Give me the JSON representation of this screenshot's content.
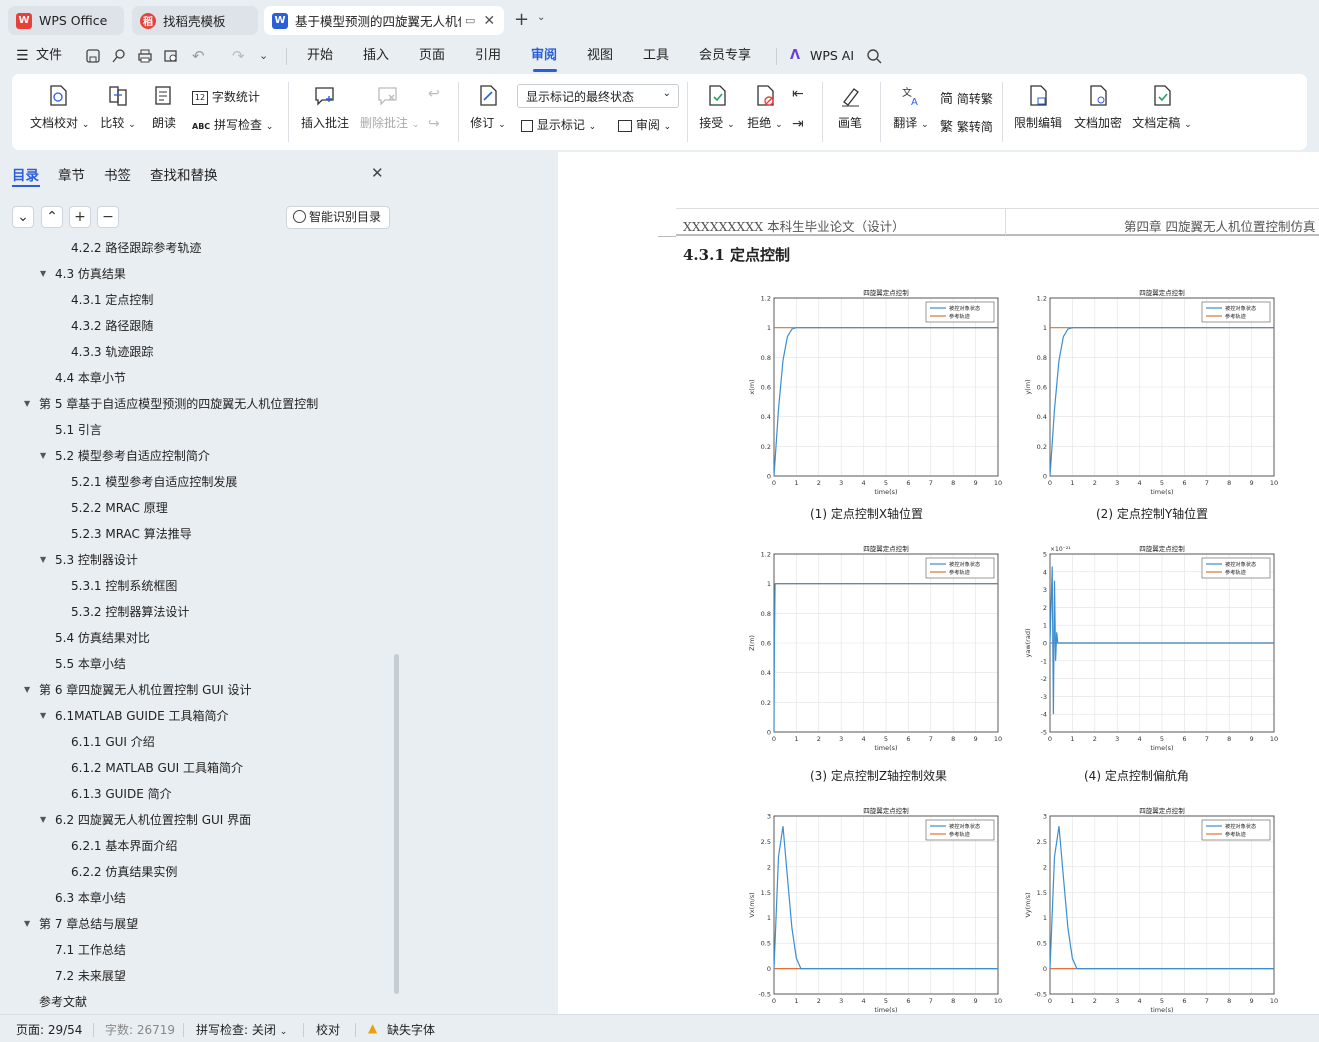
{
  "tabs": [
    {
      "label": "WPS Office",
      "icon": "wps-logo-icon"
    },
    {
      "label": "找稻壳模板",
      "icon": "docer-icon"
    },
    {
      "label": "基于模型预测的四旋翼无人机位",
      "icon": "word-doc-icon"
    }
  ],
  "menu": {
    "file": "文件",
    "items": [
      "开始",
      "插入",
      "页面",
      "引用",
      "审阅",
      "视图",
      "工具",
      "会员专享"
    ],
    "active": "审阅",
    "ai": "WPS AI"
  },
  "ribbon": {
    "doc_check": "文档校对",
    "compare": "比较",
    "read_aloud": "朗读",
    "word_count": "字数统计",
    "spell_check": "拼写检查",
    "insert_comment": "插入批注",
    "delete_comment": "删除批注",
    "revise": "修订",
    "markup_state": "显示标记的最终状态",
    "show_markup": "显示标记",
    "review": "审阅",
    "accept": "接受",
    "reject": "拒绝",
    "pen": "画笔",
    "translate": "翻译",
    "to_traditional": "简转繁",
    "to_simplified": "繁转简",
    "restrict_edit": "限制编辑",
    "encrypt": "文档加密",
    "finalize": "文档定稿"
  },
  "nav": {
    "tabs": [
      "目录",
      "章节",
      "书签",
      "查找和替换"
    ],
    "active_tab": "目录",
    "smart_toc": "智能识别目录",
    "items": [
      {
        "label": "4.2.2 路径跟踪参考轨迹",
        "level": 3
      },
      {
        "label": "4.3 仿真结果",
        "level": 2,
        "expanded": true
      },
      {
        "label": "4.3.1 定点控制",
        "level": 3
      },
      {
        "label": "4.3.2 路径跟随",
        "level": 3
      },
      {
        "label": "4.3.3 轨迹跟踪",
        "level": 3
      },
      {
        "label": "4.4 本章小节",
        "level": 2
      },
      {
        "label": "第 5 章基于自适应模型预测的四旋翼无人机位置控制",
        "level": 1,
        "expanded": true
      },
      {
        "label": "5.1 引言",
        "level": 2
      },
      {
        "label": "5.2 模型参考自适应控制简介",
        "level": 2,
        "expanded": true
      },
      {
        "label": "5.2.1 模型参考自适应控制发展",
        "level": 3
      },
      {
        "label": "5.2.2 MRAC 原理",
        "level": 3
      },
      {
        "label": "5.2.3 MRAC 算法推导",
        "level": 3
      },
      {
        "label": "5.3 控制器设计",
        "level": 2,
        "expanded": true
      },
      {
        "label": "5.3.1 控制系统框图",
        "level": 3
      },
      {
        "label": "5.3.2 控制器算法设计",
        "level": 3
      },
      {
        "label": "5.4 仿真结果对比",
        "level": 2
      },
      {
        "label": "5.5  本章小结",
        "level": 2
      },
      {
        "label": "第 6 章四旋翼无人机位置控制 GUI 设计",
        "level": 1,
        "expanded": true
      },
      {
        "label": "6.1MATLAB GUIDE 工具箱简介",
        "level": 2,
        "expanded": true
      },
      {
        "label": "6.1.1 GUI 介绍",
        "level": 3
      },
      {
        "label": "6.1.2 MATLAB  GUI 工具箱简介",
        "level": 3
      },
      {
        "label": "6.1.3 GUIDE 简介",
        "level": 3
      },
      {
        "label": "6.2 四旋翼无人机位置控制 GUI 界面",
        "level": 2,
        "expanded": true
      },
      {
        "label": "6.2.1  基本界面介绍",
        "level": 3
      },
      {
        "label": "6.2.2  仿真结果实例",
        "level": 3
      },
      {
        "label": "6.3  本章小结",
        "level": 2
      },
      {
        "label": "第 7 章总结与展望",
        "level": 1,
        "expanded": true
      },
      {
        "label": "7.1 工作总结",
        "level": 2
      },
      {
        "label": "7.2 未来展望",
        "level": 2
      },
      {
        "label": "参考文献",
        "level": 1
      }
    ]
  },
  "doc": {
    "header_left": "XXXXXXXXX 本科生毕业论文（设计）",
    "header_right": "第四章  四旋翼无人机位置控制仿真",
    "section_title": "4.3.1 定点控制",
    "captions": [
      "(1)   定点控制X轴位置",
      "(2)   定点控制Y轴位置",
      "(3)   定点控制Z轴控制效果",
      "(4)  定点控制偏航角"
    ]
  },
  "chart_data": [
    {
      "type": "line",
      "title": "四旋翼定点控制",
      "xlabel": "time(s)",
      "ylabel": "x(m)",
      "xlim": [
        0,
        10
      ],
      "ylim": [
        0,
        1.2
      ],
      "xticks": [
        0,
        1,
        2,
        3,
        4,
        5,
        6,
        7,
        8,
        9,
        10
      ],
      "yticks": [
        0,
        0.2,
        0.4,
        0.6,
        0.8,
        1,
        1.2
      ],
      "grid": true,
      "legend": "top-right",
      "series": [
        {
          "name": "被控对象状态",
          "color": "#3c8ed0",
          "x": [
            0,
            0.2,
            0.4,
            0.6,
            0.8,
            1,
            10
          ],
          "y": [
            0,
            0.45,
            0.78,
            0.94,
            0.99,
            1,
            1
          ]
        },
        {
          "name": "参考轨迹",
          "color": "#e0703a",
          "x": [
            0,
            10
          ],
          "y": [
            1,
            1
          ]
        }
      ]
    },
    {
      "type": "line",
      "title": "四旋翼定点控制",
      "xlabel": "time(s)",
      "ylabel": "y(m)",
      "xlim": [
        0,
        10
      ],
      "ylim": [
        0,
        1.2
      ],
      "xticks": [
        0,
        1,
        2,
        3,
        4,
        5,
        6,
        7,
        8,
        9,
        10
      ],
      "yticks": [
        0,
        0.2,
        0.4,
        0.6,
        0.8,
        1,
        1.2
      ],
      "grid": true,
      "legend": "top-right",
      "series": [
        {
          "name": "被控对象状态",
          "color": "#3c8ed0",
          "x": [
            0,
            0.2,
            0.4,
            0.6,
            0.8,
            1,
            10
          ],
          "y": [
            0,
            0.45,
            0.78,
            0.94,
            0.99,
            1,
            1
          ]
        },
        {
          "name": "参考轨迹",
          "color": "#e0703a",
          "x": [
            0,
            10
          ],
          "y": [
            1,
            1
          ]
        }
      ]
    },
    {
      "type": "line",
      "title": "四旋翼定点控制",
      "xlabel": "time(s)",
      "ylabel": "Z(m)",
      "xlim": [
        0,
        10
      ],
      "ylim": [
        0,
        1.2
      ],
      "xticks": [
        0,
        1,
        2,
        3,
        4,
        5,
        6,
        7,
        8,
        9,
        10
      ],
      "yticks": [
        0,
        0.2,
        0.4,
        0.6,
        0.8,
        1,
        1.2
      ],
      "grid": true,
      "legend": "top-right",
      "series": [
        {
          "name": "被控对象状态",
          "color": "#3c8ed0",
          "x": [
            0,
            0.02,
            0.05,
            10
          ],
          "y": [
            0,
            0.6,
            1,
            1
          ]
        },
        {
          "name": "参考轨迹",
          "color": "#e0703a",
          "x": [
            0,
            10
          ],
          "y": [
            1,
            1
          ]
        }
      ]
    },
    {
      "type": "line",
      "title": "四旋翼定点控制",
      "xlabel": "time(s)",
      "ylabel": "yaw(rad)",
      "xlim": [
        0,
        10
      ],
      "ylim": [
        -5,
        5
      ],
      "y_exponent": "×10⁻²¹",
      "xticks": [
        0,
        1,
        2,
        3,
        4,
        5,
        6,
        7,
        8,
        9,
        10
      ],
      "yticks": [
        -5,
        -4,
        -3,
        -2,
        -1,
        0,
        1,
        2,
        3,
        4,
        5
      ],
      "grid": true,
      "legend": "top-right",
      "series": [
        {
          "name": "被控对象状态",
          "color": "#3c8ed0",
          "x": [
            0,
            0.1,
            0.15,
            0.2,
            0.25,
            0.3,
            0.35,
            10
          ],
          "y": [
            0,
            4.3,
            -4,
            3.5,
            -1,
            0.6,
            0,
            0
          ]
        },
        {
          "name": "参考轨迹",
          "color": "#e0703a",
          "x": [
            0,
            10
          ],
          "y": [
            0,
            0
          ]
        }
      ]
    },
    {
      "type": "line",
      "title": "四旋翼定点控制",
      "xlabel": "time(s)",
      "ylabel": "Vx(m/s)",
      "xlim": [
        0,
        10
      ],
      "ylim": [
        -0.5,
        3
      ],
      "xticks": [
        0,
        1,
        2,
        3,
        4,
        5,
        6,
        7,
        8,
        9,
        10
      ],
      "yticks": [
        -0.5,
        0,
        0.5,
        1,
        1.5,
        2,
        2.5,
        3
      ],
      "grid": true,
      "legend": "top-right",
      "series": [
        {
          "name": "被控对象状态",
          "color": "#3c8ed0",
          "x": [
            0,
            0.2,
            0.4,
            0.6,
            0.8,
            1,
            1.2,
            10
          ],
          "y": [
            0,
            2.2,
            2.8,
            1.8,
            0.8,
            0.2,
            0,
            0
          ]
        },
        {
          "name": "参考轨迹",
          "color": "#e0703a",
          "x": [
            0,
            10
          ],
          "y": [
            0,
            0
          ]
        }
      ]
    },
    {
      "type": "line",
      "title": "四旋翼定点控制",
      "xlabel": "time(s)",
      "ylabel": "Vy(m/s)",
      "xlim": [
        0,
        10
      ],
      "ylim": [
        -0.5,
        3
      ],
      "xticks": [
        0,
        1,
        2,
        3,
        4,
        5,
        6,
        7,
        8,
        9,
        10
      ],
      "yticks": [
        -0.5,
        0,
        0.5,
        1,
        1.5,
        2,
        2.5,
        3
      ],
      "grid": true,
      "legend": "top-right",
      "series": [
        {
          "name": "被控对象状态",
          "color": "#3c8ed0",
          "x": [
            0,
            0.2,
            0.4,
            0.6,
            0.8,
            1,
            1.2,
            10
          ],
          "y": [
            0,
            2.2,
            2.8,
            1.8,
            0.8,
            0.2,
            0,
            0
          ]
        },
        {
          "name": "参考轨迹",
          "color": "#e0703a",
          "x": [
            0,
            10
          ],
          "y": [
            0,
            0
          ]
        }
      ]
    }
  ],
  "status": {
    "page": "页面: 29/54",
    "words": "字数: 26719",
    "spell": "拼写检查: 关闭",
    "proof": "校对",
    "missing_font": "缺失字体"
  },
  "colors": {
    "accent": "#2b5fd9",
    "wps_red": "#e8413c",
    "series_blue": "#3c8ed0",
    "series_orange": "#e0703a"
  }
}
